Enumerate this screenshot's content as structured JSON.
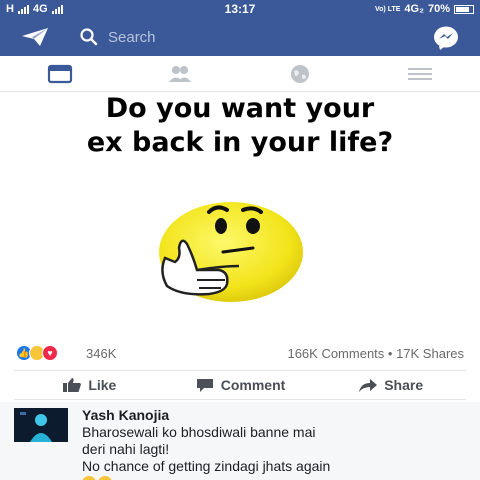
{
  "status_bar": {
    "left_network_1": "H",
    "left_network_2": "4G",
    "time": "13:17",
    "right_volte": "Vo) LTE",
    "right_network": "4G₂",
    "battery_percent": "70%"
  },
  "app_bar": {
    "search_placeholder": "Search",
    "left_icon": "send-icon",
    "right_icon": "messenger-icon"
  },
  "nav_tabs": [
    {
      "name": "news-feed",
      "icon": "newsfeed-icon",
      "active": true
    },
    {
      "name": "friends",
      "icon": "friends-icon",
      "active": false
    },
    {
      "name": "notifications",
      "icon": "globe-icon",
      "active": false
    },
    {
      "name": "menu",
      "icon": "hamburger-menu-icon",
      "active": false
    }
  ],
  "post": {
    "image_text": "Do you want your ex back in your life?",
    "image_text_line1": "Do you want your",
    "image_text_line2": "ex back in your life?",
    "reaction_count": "346K",
    "comments_shares": "166K Comments • 17K Shares"
  },
  "actions": {
    "like_label": "Like",
    "comment_label": "Comment",
    "share_label": "Share"
  },
  "comment": {
    "author": "Yash Kanojia",
    "line1": "Bharosewali ko bhosdiwali banne mai",
    "line2": "deri nahi lagti!",
    "line3": "No chance of getting zindagi jhats again"
  },
  "colors": {
    "brand_blue": "#3b5998",
    "like_blue": "#1877f2",
    "love_red": "#f0284a",
    "emoji_yellow": "#f7e11a"
  }
}
